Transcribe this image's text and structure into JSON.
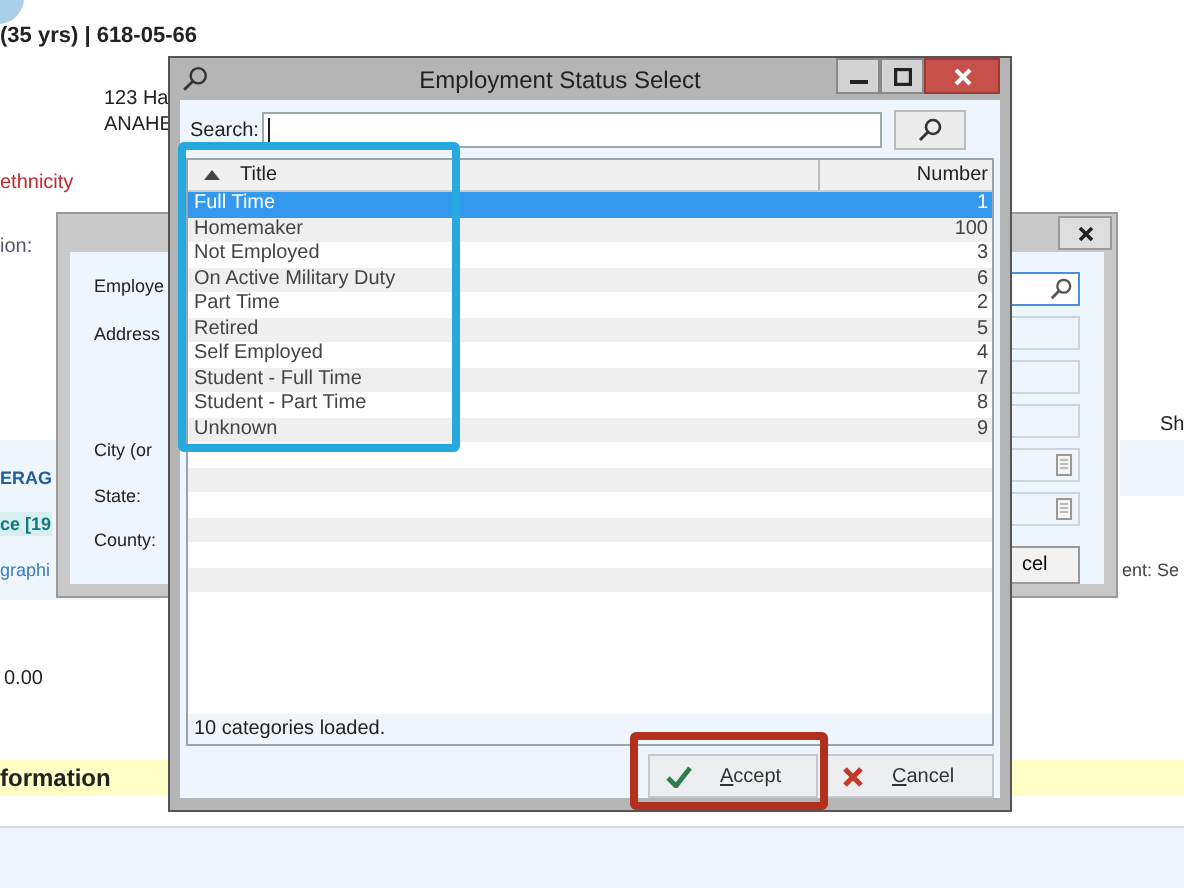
{
  "background_page": {
    "patient_line": "(35 yrs) | 618-05-66",
    "address_lines": [
      "123 Ha",
      "ANAHE"
    ],
    "ethnicity_link": "ethnicity",
    "field_label": "ion:",
    "section_heading": "ERAG",
    "coverage_item": "ce [19",
    "demographics_link": "graphi",
    "amount": "0.00",
    "information_heading": "formation",
    "right_label": "Sh",
    "right_field": "ent: Se"
  },
  "address_dialog": {
    "labels": [
      "Employe",
      "Address",
      "City (or",
      "State:",
      "County:"
    ],
    "button_label": "cel"
  },
  "dialog": {
    "title": "Employment Status Select",
    "search_label": "Search:",
    "table": {
      "columns": [
        {
          "label": "Title",
          "sorted_ascending": true
        },
        {
          "label": "Number",
          "sorted_ascending": false
        }
      ],
      "rows": [
        {
          "title": "Full Time",
          "number": "1",
          "selected": true
        },
        {
          "title": "Homemaker",
          "number": "100",
          "selected": false
        },
        {
          "title": "Not Employed",
          "number": "3",
          "selected": false
        },
        {
          "title": "On Active Military Duty",
          "number": "6",
          "selected": false
        },
        {
          "title": "Part Time",
          "number": "2",
          "selected": false
        },
        {
          "title": "Retired",
          "number": "5",
          "selected": false
        },
        {
          "title": "Self Employed",
          "number": "4",
          "selected": false
        },
        {
          "title": "Student - Full Time",
          "number": "7",
          "selected": false
        },
        {
          "title": "Student - Part Time",
          "number": "8",
          "selected": false
        },
        {
          "title": "Unknown",
          "number": "9",
          "selected": false
        }
      ]
    },
    "status": "10 categories loaded.",
    "buttons": [
      {
        "kind": "accept",
        "label": "Accept"
      },
      {
        "kind": "cancel",
        "label": "Cancel"
      }
    ]
  },
  "highlights": [
    {
      "color": "#26a9de"
    },
    {
      "color": "#b3301f"
    }
  ]
}
